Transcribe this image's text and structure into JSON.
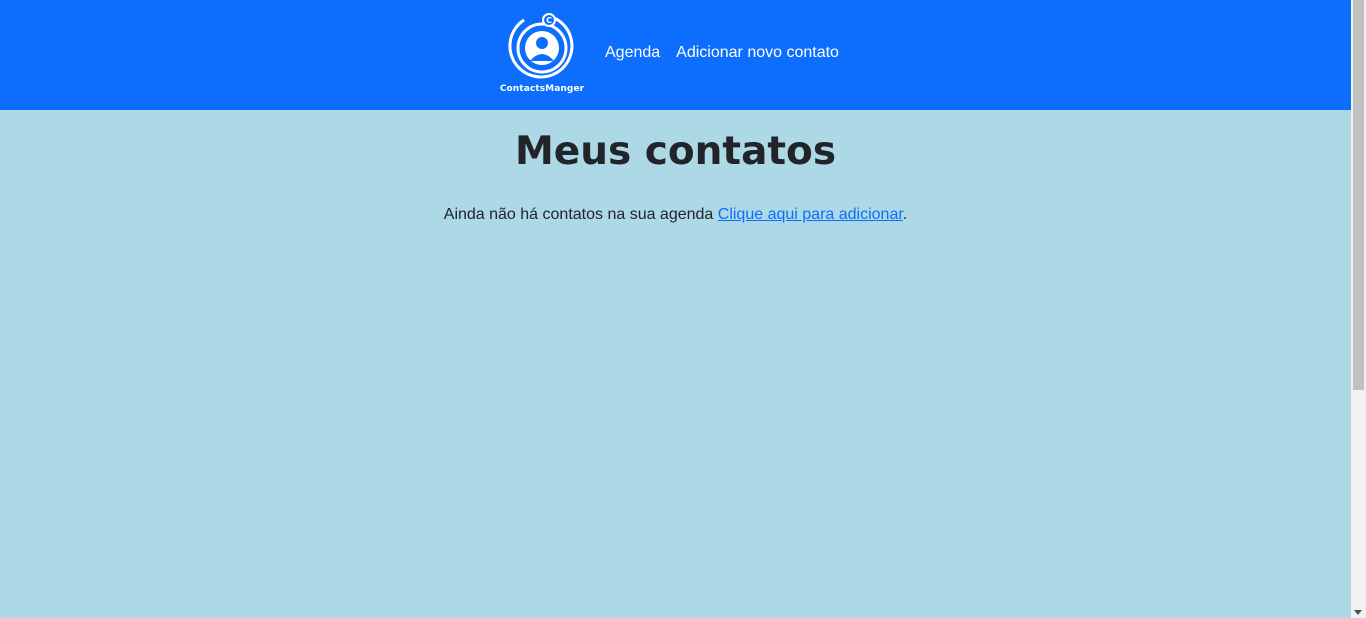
{
  "colors": {
    "navbar_bg": "#0d6efd",
    "page_bg": "#add8e6",
    "text": "#212529",
    "link": "#0d6efd"
  },
  "brand": {
    "icon": "contact-person-logo-icon",
    "name": "ContactsManger"
  },
  "nav": {
    "items": [
      {
        "label": "Agenda"
      },
      {
        "label": "Adicionar novo contato"
      }
    ]
  },
  "main": {
    "title": "Meus contatos",
    "empty_text": "Ainda não há contatos na sua agenda ",
    "empty_link": "Clique aqui para adicionar",
    "empty_suffix": "."
  }
}
